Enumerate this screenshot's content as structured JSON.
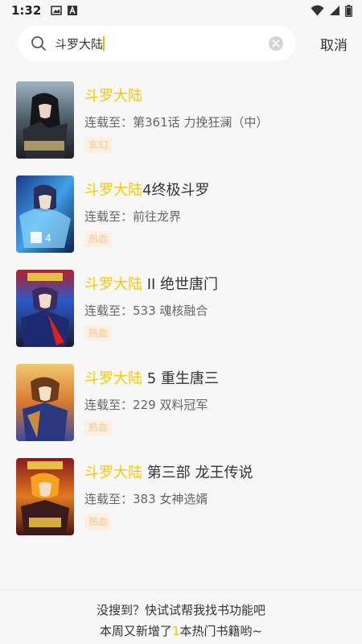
{
  "status_bar": {
    "time": "1:32",
    "left_icons": [
      "image-icon",
      "a-icon"
    ],
    "right_icons": [
      "wifi-icon",
      "signal-icon",
      "battery-icon"
    ]
  },
  "search": {
    "value": "斗罗大陆",
    "cancel_label": "取消"
  },
  "highlight_color": "#f5c800",
  "results": [
    {
      "title_highlight": "斗罗大陆",
      "title_rest": "",
      "update_prefix": "连载至：",
      "update_text": "第361话 力挽狂澜（中）",
      "tag": "玄幻"
    },
    {
      "title_highlight": "斗罗大陆",
      "title_rest": "4终极斗罗",
      "update_prefix": "连载至：",
      "update_text": "前往龙界",
      "tag": "热血"
    },
    {
      "title_highlight": "斗罗大陆",
      "title_rest": " II 绝世唐门",
      "update_prefix": "连载至：",
      "update_text": "533 魂核融合",
      "tag": "热血"
    },
    {
      "title_highlight": "斗罗大陆",
      "title_rest": " 5 重生唐三",
      "update_prefix": "连载至：",
      "update_text": "229 双料冠军",
      "tag": "热血"
    },
    {
      "title_highlight": "斗罗大陆",
      "title_rest": " 第三部 龙王传说",
      "update_prefix": "连载至：",
      "update_text": "383 女神选婿",
      "tag": "热血"
    }
  ],
  "footer": {
    "line1": "没搜到？快试试帮我找书功能吧",
    "line2_prefix": "本周又新增了",
    "line2_count": "1",
    "line2_suffix": "本热门书籍哟~"
  }
}
